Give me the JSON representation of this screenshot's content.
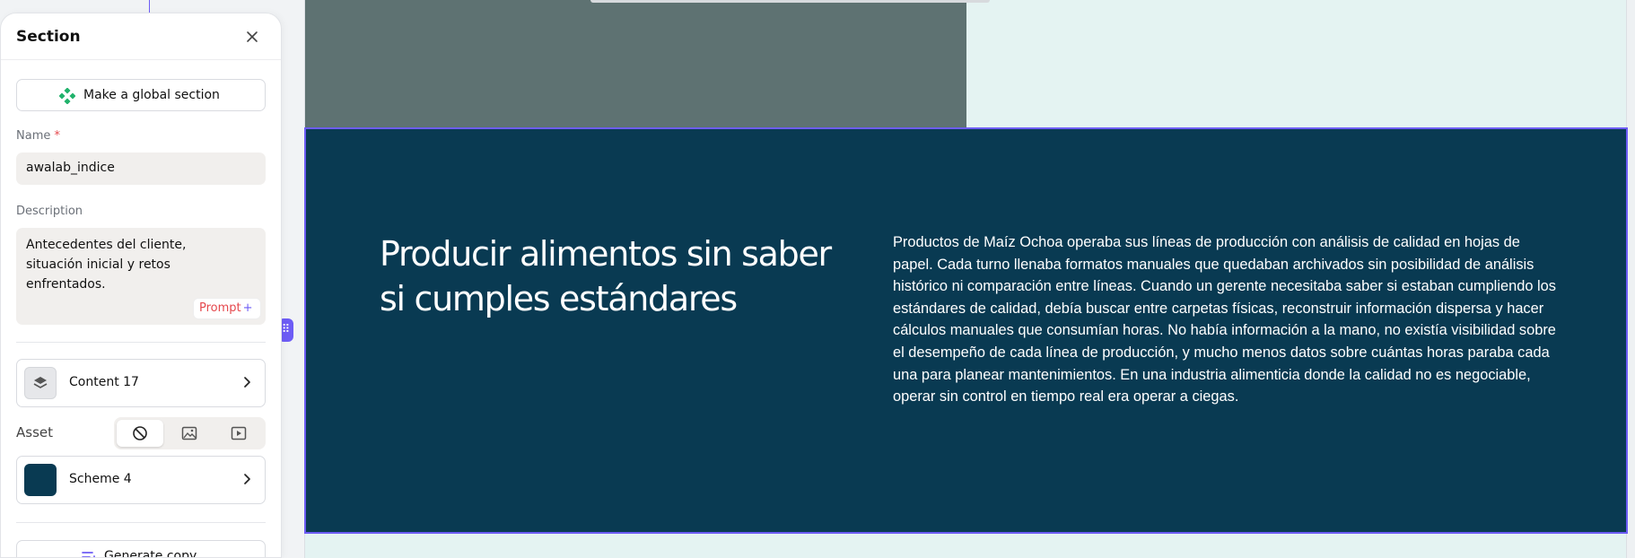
{
  "panel": {
    "title": "Section",
    "global_button_label": "Make a global section",
    "name_label": "Name",
    "name_required_mark": "*",
    "name_value": "awalab_indice",
    "description_label": "Description",
    "description_value": "Antecedentes del cliente, situación inicial y retos enfrentados.",
    "prompt_label": "Prompt",
    "prompt_spark": "+",
    "content_item_label": "Content 17",
    "asset_label": "Asset",
    "asset_options": [
      "none",
      "image",
      "video"
    ],
    "asset_selected": "none",
    "scheme_label": "Scheme 4",
    "scheme_color": "#093a52",
    "generate_label": "Generate copy"
  },
  "section": {
    "heading": "Producir alimentos sin saber si cumples estándares",
    "body": "Productos de Maíz Ochoa operaba sus líneas de producción con análisis de calidad en hojas de papel. Cada turno llenaba formatos manuales que quedaban archivados sin posibilidad de análisis histórico ni comparación entre líneas. Cuando un gerente necesitaba saber si estaban cumpliendo los estándares de calidad, debía buscar entre carpetas físicas, reconstruir información dispersa y hacer cálculos manuales que consumían horas. No había información a la mano, no existía visibilidad sobre el desempeño de cada línea de producción, y mucho menos datos sobre cuántas horas paraba cada una para planear mantenimientos. En una industria alimenticia donde la calidad no es negociable, operar sin control en tiempo real era operar a ciegas.",
    "background": "#093a52",
    "selection_color": "#6d5cf5"
  },
  "colors": {
    "accent": "#6d5cf5",
    "required": "#e5484d",
    "upper_block": "#5e7272",
    "mint": "#e4f3f2"
  }
}
